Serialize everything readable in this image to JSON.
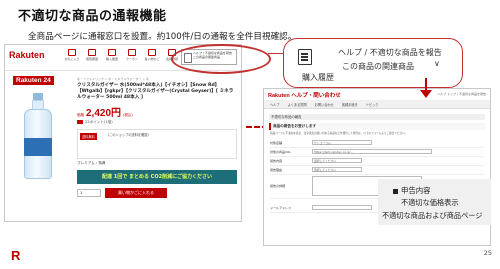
{
  "slide": {
    "title": "不適切な商品の通報機能",
    "subtitle": "全商品ページに通報窓口を設置。約100件/日の通報を全件目視確認。",
    "page_number": "25",
    "footer_logo": "R"
  },
  "left_screenshot": {
    "logo": "Rakuten",
    "nav_icons": [
      {
        "label": "お気に入り",
        "icon": "heart-icon"
      },
      {
        "label": "閲覧履歴",
        "icon": "history-icon"
      },
      {
        "label": "購入履歴",
        "icon": "receipt-icon"
      },
      {
        "label": "クーポン",
        "icon": "coupon-icon"
      },
      {
        "label": "買い物かご",
        "icon": "cart-icon"
      },
      {
        "label": "会員登録",
        "icon": "user-icon"
      }
    ],
    "help_button": "ヘルプ / 不適切な商品を報告 この商品の関連商品",
    "brand_badge": "Rakuten 24",
    "breadcrumb": "水・ソフトドリンク > 水・ミネラルウォーター > 水",
    "product_name": "クリスタルガイザー 水(500ml*48本入)【イチオシ】【Snow Rd】【Wtgalb】【rgkpr】【クリスタルガイザー(Crystal Geyser)】[ ミネラルウォーター 500ml 48本入 ]",
    "price_lead": "価格",
    "price": "2,420円",
    "price_tax": "(税込)",
    "points": "22ポイント(1倍)",
    "shipping_badge": "送料無料",
    "shipping_text": "(このショップの送料を確認)",
    "premium_text": "プレミアム・特典",
    "banner_text": "配達 1回で まとめる CO2削減にご協力ください",
    "quantity": "1",
    "cart_button": "買い物かごに入れる"
  },
  "right_screenshot": {
    "logo": "Rakuten ヘルプ・問い合わせ",
    "header_links": "ヘルプ トップ | 不適切な商品を報告",
    "nav_items": [
      "ヘルプ",
      "よくある質問",
      "お問い合わせ",
      "各種手続き",
      "トピック"
    ],
    "section_label": "不適切な商品の報告",
    "heading": "商品の報告をお受けします",
    "paragraph": "商品ページに不適切な表示、法令違反の疑いがある商品などを発見した場合は、以下のフォームよりご報告ください。",
    "form_rows": [
      {
        "label": "対象店舗",
        "value": "ケンコーコム"
      },
      {
        "label": "対象の商品URL",
        "value": "https://item.rakuten.co.jp/..."
      },
      {
        "label": "報告内容",
        "value": "選択してください"
      },
      {
        "label": "報告理由",
        "value": "選択してください"
      },
      {
        "label": "報告の詳細",
        "value": ""
      }
    ],
    "mail_label": "メールアドレス"
  },
  "callout": {
    "line1": "ヘルプ / 不適切な商品を報告",
    "line2": "この商品の関連商品",
    "caret": "∨",
    "line3": "購入履歴"
  },
  "report_box": {
    "title": "申告内容",
    "item1": "不適切な価格表示",
    "item2": "不適切な商品および商品ページ"
  },
  "colors": {
    "brand_red": "#bf0000",
    "highlight_red": "#c33030"
  }
}
